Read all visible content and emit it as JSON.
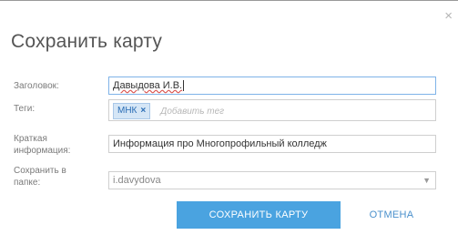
{
  "dialog": {
    "title": "Сохранить карту",
    "close_glyph": "×"
  },
  "form": {
    "title_label": "Заголовок:",
    "title_value": "Давыдова И.В.",
    "tags_label": "Теги:",
    "tags": [
      "МНК"
    ],
    "tag_remove_glyph": "×",
    "tags_placeholder": "Добавить тег",
    "summary_label_line1": "Краткая",
    "summary_label_line2": "информация:",
    "summary_value": "Информация про Многопрофильный колледж",
    "folder_label_line1": "Сохранить в",
    "folder_label_line2": "папке:",
    "folder_value": "i.davydova",
    "folder_arrow_icon": "chevron-down-icon"
  },
  "buttons": {
    "save": "СОХРАНИТЬ КАРТУ",
    "cancel": "ОТМЕНА"
  },
  "colors": {
    "accent": "#4aa3e0",
    "link": "#4a90cc",
    "tag_bg": "#d5e6f6"
  }
}
